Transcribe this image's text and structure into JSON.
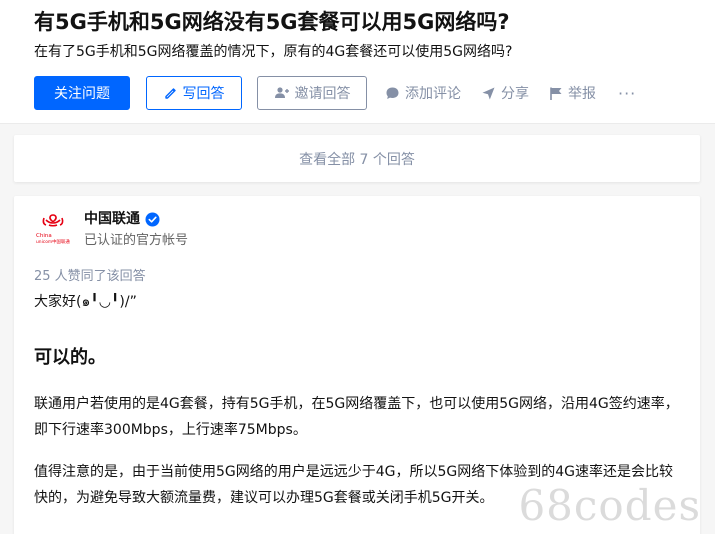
{
  "question": {
    "title": "有5G手机和5G网络没有5G套餐可以用5G网络吗?",
    "detail": "在有了5G手机和5G网络覆盖的情况下，原有的4G套餐还可以使用5G网络吗?",
    "actions": {
      "follow": "关注问题",
      "write_answer": "写回答",
      "invite": "邀请回答",
      "comment": "添加评论",
      "share": "分享",
      "report": "举报",
      "more": "···"
    },
    "icons": {
      "write": "pencil-icon",
      "invite": "add-user-icon",
      "comment": "comment-bubble-icon",
      "share": "share-arrow-icon",
      "report": "flag-icon"
    }
  },
  "view_all": "查看全部 7 个回答",
  "answer": {
    "author": {
      "name": "中国联通",
      "headline": "已认证的官方帐号",
      "avatar_text": "China unicom中国联通",
      "avatar_icon": "china-unicom-logo"
    },
    "votes": "25 人赞同了该回答",
    "greeting": "大家好(๑╹◡╹)/”",
    "heading": "可以的。",
    "paragraphs": [
      "联通用户若使用的是4G套餐，持有5G手机，在5G网络覆盖下，也可以使用5G网络，沿用4G签约速率，即下行速率300Mbps，上行速率75Mbps。",
      "值得注意的是，由于当前使用5G网络的用户是远远少于4G，所以5G网络下体验到的4G速率还是会比较快的，为避免导致大额流量费，建议可以办理5G套餐或关闭手机5G开关。"
    ]
  },
  "watermark": "68codes",
  "colors": {
    "primary": "#0066ff",
    "muted": "#8590a6",
    "unicom_red": "#e60012"
  }
}
